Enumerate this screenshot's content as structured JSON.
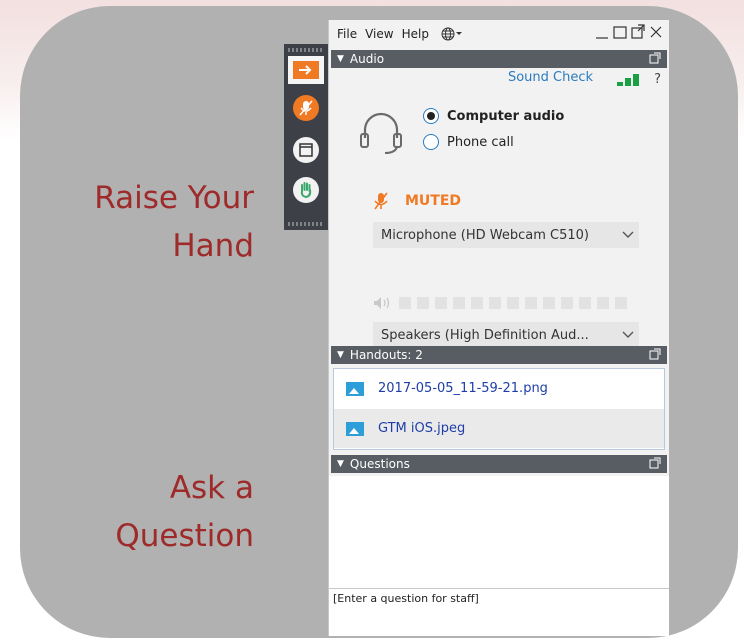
{
  "annotations": {
    "raise_hand_line1": "Raise Your",
    "raise_hand_line2": "Hand",
    "ask_line1": "Ask a",
    "ask_line2": "Question"
  },
  "menu": {
    "file": "File",
    "view": "View",
    "help": "Help",
    "language_icon": "globe-icon"
  },
  "audio": {
    "header": "Audio",
    "sound_check": "Sound Check",
    "help_symbol": "?",
    "options": [
      {
        "label": "Computer audio",
        "selected": true
      },
      {
        "label": "Phone call",
        "selected": false
      }
    ],
    "muted_label": "MUTED",
    "microphone": "Microphone (HD Webcam C510)",
    "speakers": "Speakers (High Definition Aud...",
    "signal_level": 3
  },
  "handouts": {
    "header": "Handouts: 2",
    "files": [
      {
        "name": "2017-05-05_11-59-21.png"
      },
      {
        "name": "GTM iOS.jpeg"
      }
    ]
  },
  "questions": {
    "header": "Questions",
    "input_placeholder": "[Enter a question for staff]"
  },
  "colors": {
    "accent_orange": "#f07a24",
    "header_gray": "#585d63",
    "link_blue": "#1f3ea8",
    "annotation_red": "#9e2a2a"
  }
}
